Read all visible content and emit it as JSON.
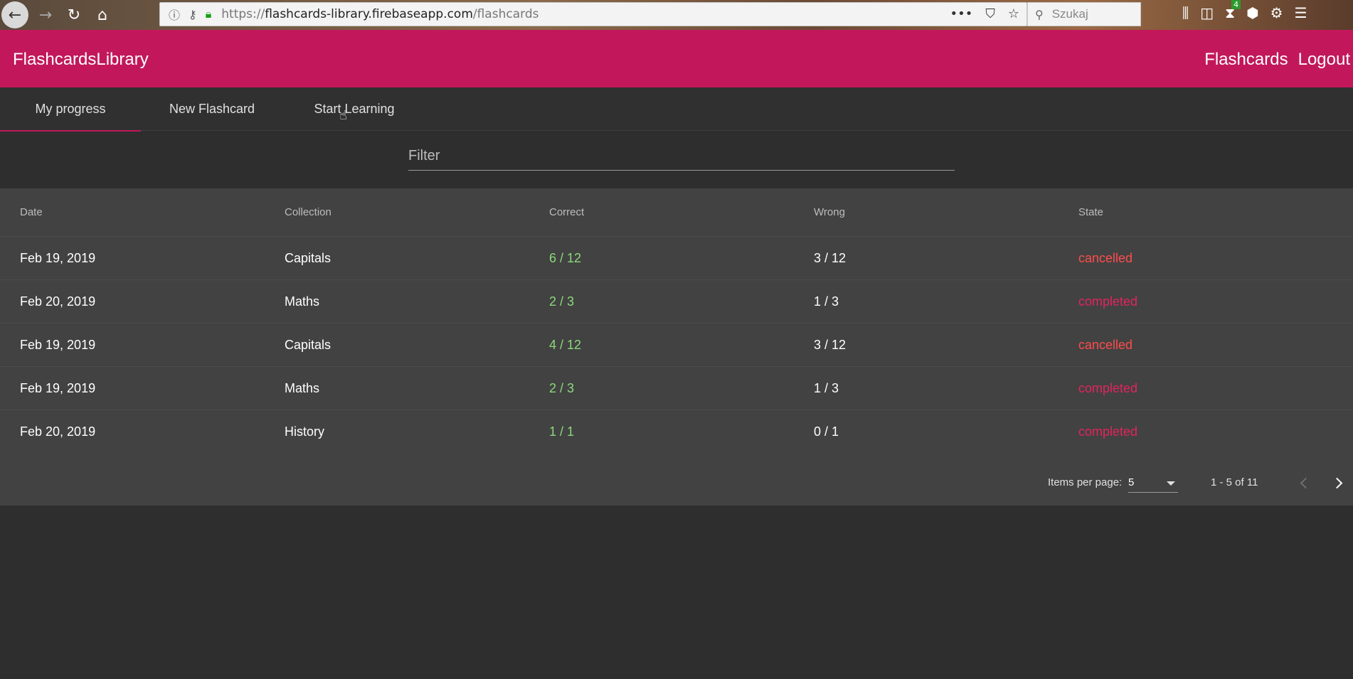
{
  "browser": {
    "url_prefix": "https://",
    "url_host": "flashcards-library.firebaseapp.com",
    "url_path": "/flashcards",
    "search_placeholder": "Szukaj",
    "badge_count": "4"
  },
  "header": {
    "brand": "FlashcardsLibrary",
    "links": [
      "Flashcards",
      "Logout"
    ]
  },
  "tabs": [
    {
      "label": "My progress",
      "active": true
    },
    {
      "label": "New Flashcard",
      "active": false
    },
    {
      "label": "Start Learning",
      "active": false
    }
  ],
  "filter": {
    "placeholder": "Filter"
  },
  "table": {
    "columns": [
      "Date",
      "Collection",
      "Correct",
      "Wrong",
      "State"
    ],
    "rows": [
      {
        "date": "Feb 19, 2019",
        "collection": "Capitals",
        "correct": "6 / 12",
        "wrong": "3 / 12",
        "state": "cancelled"
      },
      {
        "date": "Feb 20, 2019",
        "collection": "Maths",
        "correct": "2 / 3",
        "wrong": "1 / 3",
        "state": "completed"
      },
      {
        "date": "Feb 19, 2019",
        "collection": "Capitals",
        "correct": "4 / 12",
        "wrong": "3 / 12",
        "state": "cancelled"
      },
      {
        "date": "Feb 19, 2019",
        "collection": "Maths",
        "correct": "2 / 3",
        "wrong": "1 / 3",
        "state": "completed"
      },
      {
        "date": "Feb 20, 2019",
        "collection": "History",
        "correct": "1 / 1",
        "wrong": "0 / 1",
        "state": "completed"
      }
    ]
  },
  "paginator": {
    "items_per_page_label": "Items per page:",
    "items_per_page_value": "5",
    "range_label": "1 - 5 of 11"
  },
  "colors": {
    "primary": "#c2185b",
    "correct": "#8bd97a",
    "cancelled": "#ff4c4c",
    "completed": "#e2245f"
  }
}
